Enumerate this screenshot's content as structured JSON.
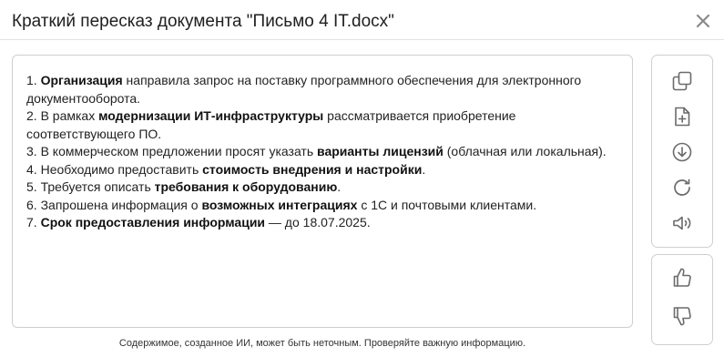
{
  "dialog": {
    "title": "Краткий пересказ документа \"Письмо 4 IT.docx\"",
    "close_icon": "close-icon"
  },
  "summary": {
    "items": [
      {
        "number": "1. ",
        "bold": "Организация",
        "before": "",
        "after": " направила запрос на поставку программного обеспечения для электронного документооборота."
      },
      {
        "number": "2. ",
        "before": "В рамках ",
        "bold": "модернизации ИТ-инфраструктуры",
        "after": " рассматривается приобретение соответствующего ПО."
      },
      {
        "number": "3. ",
        "before": "В коммерческом предложении просят указать ",
        "bold": "варианты лицензий",
        "after": " (облачная или локальная)."
      },
      {
        "number": "4. ",
        "before": "Необходимо предоставить ",
        "bold": "стоимость внедрения и настройки",
        "after": "."
      },
      {
        "number": "5. ",
        "before": "Требуется описать ",
        "bold": "требования к оборудованию",
        "after": "."
      },
      {
        "number": "6. ",
        "before": "Запрошена информация о ",
        "bold": "возможных интеграциях",
        "after": " с 1С и почтовыми клиентами."
      },
      {
        "number": "7. ",
        "before": "",
        "bold": "Срок предоставления информации",
        "after": " — до 18.07.2025."
      }
    ]
  },
  "toolbar": {
    "actions": [
      "copy-icon",
      "new-document-icon",
      "download-icon",
      "regenerate-icon",
      "speaker-icon"
    ],
    "feedback": [
      "thumbs-up-icon",
      "thumbs-down-icon"
    ]
  },
  "footer": {
    "disclaimer": "Содержимое, созданное ИИ, может быть неточным. Проверяйте важную информацию."
  },
  "colors": {
    "icon": "#6b6b6b",
    "border": "#cfcfcf"
  }
}
